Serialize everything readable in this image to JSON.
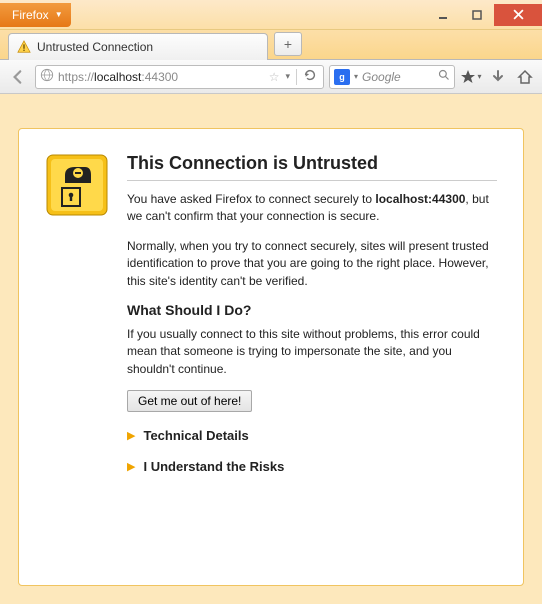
{
  "titlebar": {
    "app_button": "Firefox"
  },
  "tabs": {
    "active_title": "Untrusted Connection"
  },
  "navbar": {
    "url_prefix": "https://",
    "url_host": "localhost",
    "url_suffix": ":44300",
    "search_placeholder": "Google"
  },
  "page": {
    "h1": "This Connection is Untrusted",
    "para1_a": "You have asked Firefox to connect securely to ",
    "para1_host": "localhost:44300",
    "para1_b": ", but we can't confirm that your connection is secure.",
    "para2": "Normally, when you try to connect securely, sites will present trusted identification to prove that you are going to the right place. However, this site's identity can't be verified.",
    "h2": "What Should I Do?",
    "para3": "If you usually connect to this site without problems, this error could mean that someone is trying to impersonate the site, and you shouldn't continue.",
    "get_out_label": "Get me out of here!",
    "technical_label": "Technical Details",
    "risks_label": "I Understand the Risks"
  }
}
